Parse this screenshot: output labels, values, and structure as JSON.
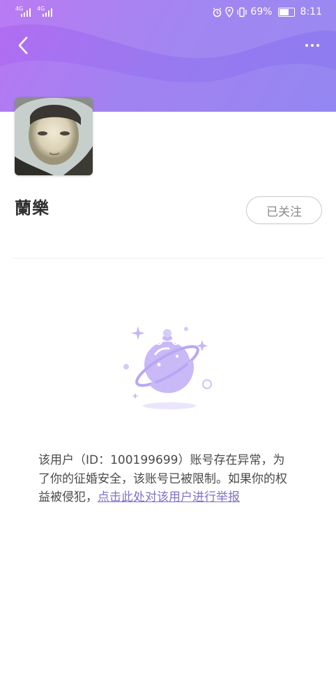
{
  "status_bar": {
    "signal_1": "4G",
    "signal_2": "4G",
    "battery_percent": "69%",
    "time": "8:11",
    "battery_level": 0.69
  },
  "header": {
    "back_icon": "chevron-left-icon",
    "more_icon": "more-horizontal-icon"
  },
  "profile": {
    "name": "蘭樂",
    "follow_label": "已关注"
  },
  "notice": {
    "text_part1": "该用户（ID：100199699）账号存在异常，为了你的征婚安全，该账号已被限制。如果你的权益被侵犯，",
    "report_link": "点击此处对该用户进行举报"
  },
  "colors": {
    "header_gradient_start": "#b36cf2",
    "header_gradient_end": "#8c7df0",
    "planet_accent": "#c9b9f7",
    "link": "#7e73c9"
  }
}
